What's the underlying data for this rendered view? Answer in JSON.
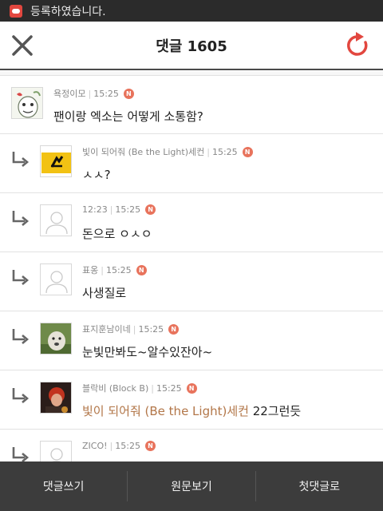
{
  "status_bar": {
    "app_icon": "app-notification-icon",
    "message": "등록하였습니다."
  },
  "header": {
    "title": "댓글 1605",
    "close_icon": "close-icon",
    "refresh_icon": "refresh-icon",
    "accent": "#e2473f"
  },
  "comments": [
    {
      "author": "욕정이모",
      "time": "15:25",
      "badge": "N",
      "text": "팬이랑 엑소는 어떻게 소통함?",
      "mention": "",
      "is_reply": false
    },
    {
      "author": "빛이 되어줘 (Be the Light)세컨",
      "time": "15:25",
      "badge": "N",
      "text": "ㅅㅅ?",
      "mention": "",
      "is_reply": true
    },
    {
      "author": "12:23",
      "time": "15:25",
      "badge": "N",
      "text": "돈으로 ㅇㅅㅇ",
      "mention": "",
      "is_reply": true
    },
    {
      "author": "표옹",
      "time": "15:25",
      "badge": "N",
      "text": "사생질로",
      "mention": "",
      "is_reply": true
    },
    {
      "author": "표지훈남이네",
      "time": "15:25",
      "badge": "N",
      "text": "눈빛만봐도~알수있잔아~",
      "mention": "",
      "is_reply": true
    },
    {
      "author": "블락비 (Block B)",
      "time": "15:25",
      "badge": "N",
      "text": " 22그런듯",
      "mention": "빛이 되어줘 (Be the Light)세컨",
      "is_reply": true
    },
    {
      "author": "ZICO!",
      "time": "15:25",
      "badge": "N",
      "text": "",
      "mention": "",
      "is_reply": true
    }
  ],
  "bottom_bar": {
    "write_label": "댓글쓰기",
    "original_label": "원문보기",
    "first_comment_label": "첫댓글로"
  }
}
